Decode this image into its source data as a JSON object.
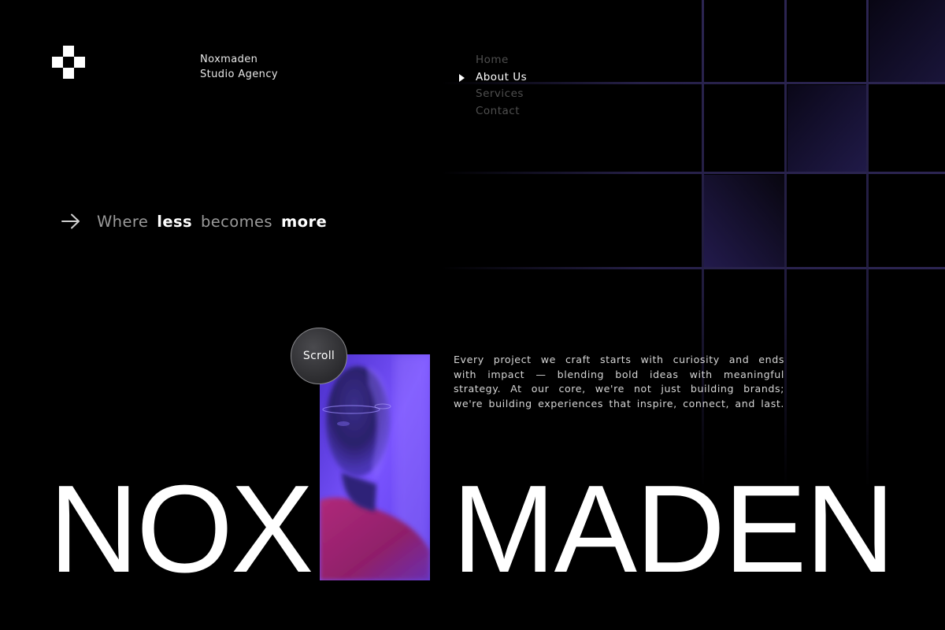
{
  "brand": {
    "name": "Noxmaden",
    "tagline": "Studio Agency"
  },
  "nav": {
    "items": [
      {
        "label": "Home",
        "active": false
      },
      {
        "label": "About Us",
        "active": true
      },
      {
        "label": "Services",
        "active": false
      },
      {
        "label": "Contact",
        "active": false
      }
    ]
  },
  "hero": {
    "tagline_words": [
      "Where",
      "less",
      "becomes",
      "more"
    ],
    "scroll_label": "Scroll",
    "description_lines": [
      "Every project we craft starts with curiosity and ends",
      "with impact — blending bold ideas with meaningful",
      "strategy. At our core, we're not just building brands;",
      "we're building experiences that inspire, connect, and last."
    ],
    "wordmark_left": "NOX",
    "wordmark_right": "MADEN"
  },
  "colors": {
    "background": "#000000",
    "accent": "#7b52ff",
    "grid_line": "#2a2350",
    "text_muted": "#4f4f4f"
  },
  "icons": {
    "logo": "pixel-cross-logo",
    "tagline": "arrow-right-icon",
    "nav_pointer": "triangle-right-icon"
  }
}
